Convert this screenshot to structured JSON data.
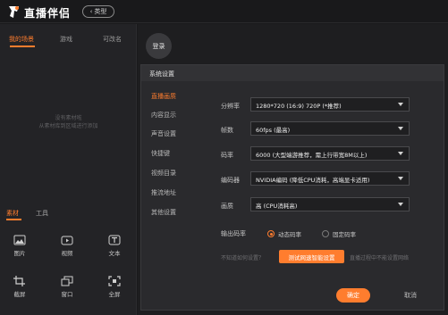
{
  "app": {
    "title": "直播伴侣",
    "mode_label": "类型"
  },
  "scene_tabs": [
    "我的场景",
    "游戏",
    "可改名"
  ],
  "empty_hint": [
    "没有素材啦",
    "从素材库到区域进行添加"
  ],
  "source_tabs": [
    "素材",
    "工具"
  ],
  "source_tiles": [
    {
      "label": "图片",
      "icon": "image-icon"
    },
    {
      "label": "视频",
      "icon": "video-icon"
    },
    {
      "label": "文本",
      "icon": "text-icon"
    },
    {
      "label": "截屏",
      "icon": "crop-icon"
    },
    {
      "label": "窗口",
      "icon": "window-icon"
    },
    {
      "label": "全屏",
      "icon": "fullscreen-icon"
    }
  ],
  "login_label": "登录",
  "dialog": {
    "title": "系统设置",
    "menu": [
      "直播画质",
      "内容显示",
      "声音设置",
      "快捷键",
      "视频目录",
      "推流地址",
      "其他设置"
    ],
    "fields": [
      {
        "label": "分辨率",
        "value": "1280*720 (16:9) 720P (*推荐)"
      },
      {
        "label": "帧数",
        "value": "60fps (最高)"
      },
      {
        "label": "码率",
        "value": "6000 (大型端游推荐，需上行带宽8M以上)"
      },
      {
        "label": "编码器",
        "value": "NVIDIA编码 (降低CPU消耗，高端显卡适用)"
      },
      {
        "label": "画质",
        "value": "高 (CPU消耗高)"
      }
    ],
    "output_label": "输出码率",
    "radio_dynamic": "动态码率",
    "radio_fixed": "固定码率",
    "help_text": "不知道如何设置？",
    "test_button": "测试网速智能设置",
    "test_hint": "直播过程中不能设置网络",
    "ok_label": "确定",
    "cancel_label": "取消"
  },
  "colors": {
    "accent": "#ff7d2e",
    "background": "#1a1a1c",
    "panel": "#232326"
  }
}
